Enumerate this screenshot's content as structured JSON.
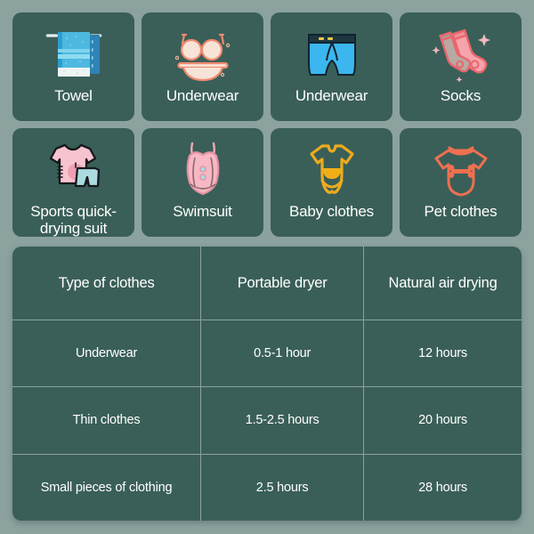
{
  "theme": {
    "background": "#8ca29e",
    "card_background": "#3a5f58",
    "text_color": "#ffffff",
    "divider_color": "rgba(255,255,255,0.42)"
  },
  "categories": [
    {
      "label": "Towel",
      "icon": "towel-icon"
    },
    {
      "label": "Underwear",
      "icon": "bra-and-panties-icon"
    },
    {
      "label": "Underwear",
      "icon": "boxer-briefs-icon"
    },
    {
      "label": "Socks",
      "icon": "socks-icon"
    },
    {
      "label": "Sports quick-\ndrying suit",
      "icon": "sports-suit-icon"
    },
    {
      "label": "Swimsuit",
      "icon": "swimsuit-icon"
    },
    {
      "label": "Baby clothes",
      "icon": "baby-onesie-icon"
    },
    {
      "label": "Pet clothes",
      "icon": "pet-shirt-icon"
    }
  ],
  "table": {
    "headers": [
      "Type of clothes",
      "Portable dryer",
      "Natural air drying"
    ],
    "rows": [
      [
        "Underwear",
        "0.5-1 hour",
        "12 hours"
      ],
      [
        "Thin clothes",
        "1.5-2.5 hours",
        "20 hours"
      ],
      [
        "Small pieces of clothing",
        "2.5 hours",
        "28 hours"
      ]
    ]
  }
}
